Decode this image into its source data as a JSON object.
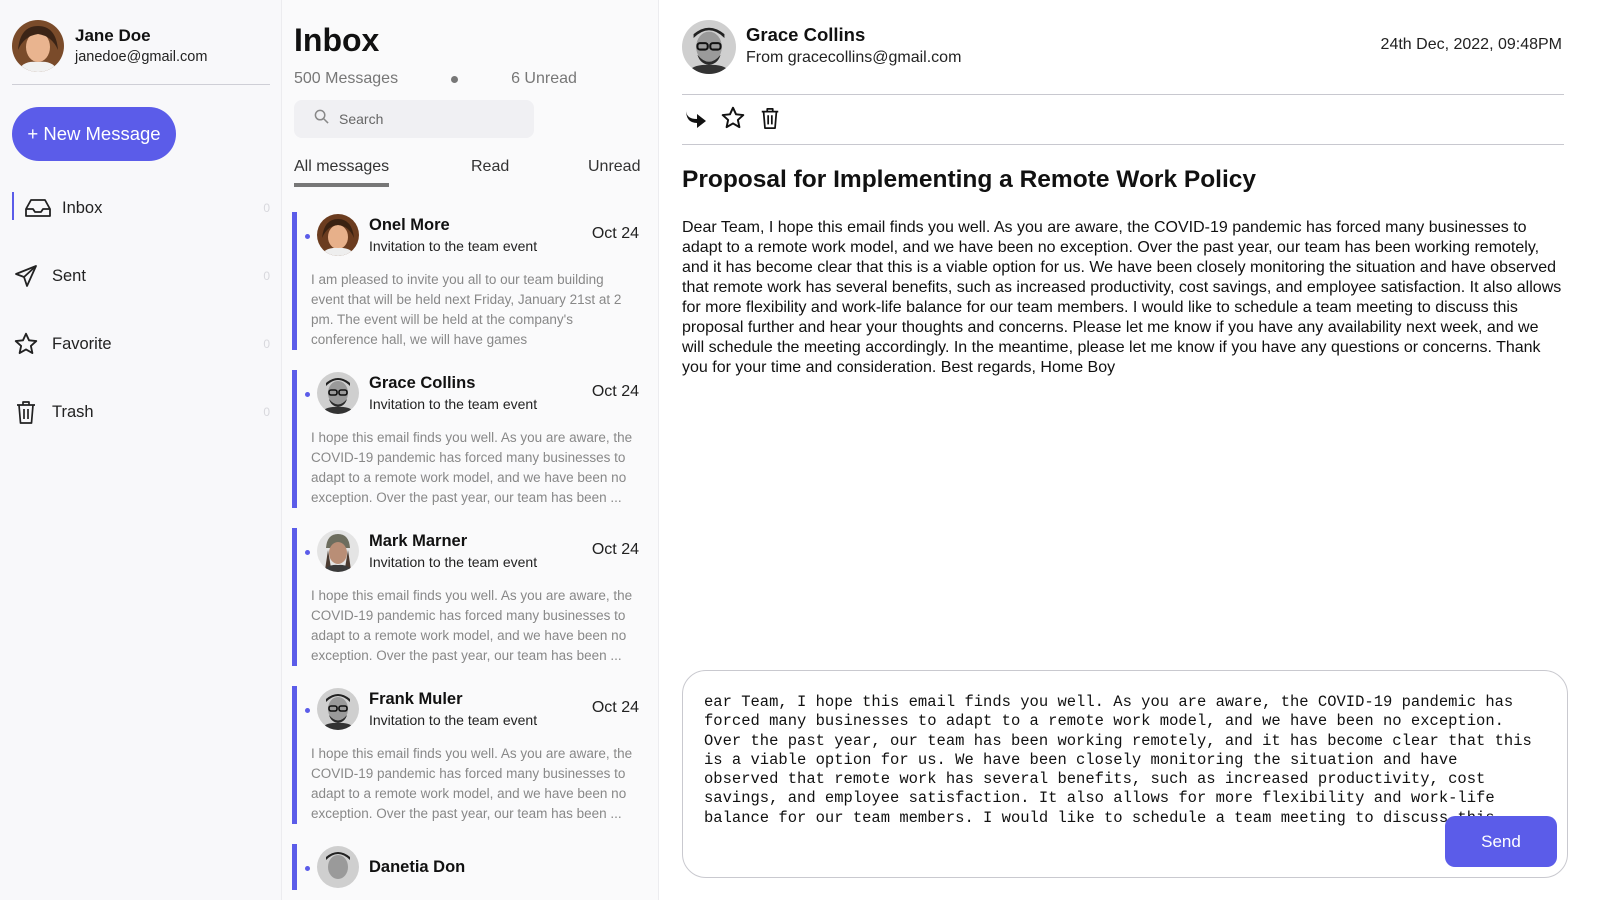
{
  "user": {
    "name": "Jane Doe",
    "email": "janedoe@gmail.com"
  },
  "sidebar": {
    "new_message_label": "+ New Message",
    "items": [
      {
        "label": "Inbox",
        "icon": "inbox-icon",
        "count": "0"
      },
      {
        "label": "Sent",
        "icon": "send-icon",
        "count": "0"
      },
      {
        "label": "Favorite",
        "icon": "star-icon",
        "count": "0"
      },
      {
        "label": "Trash",
        "icon": "trash-icon",
        "count": "0"
      }
    ]
  },
  "inbox": {
    "title": "Inbox",
    "total_label": "500 Messages",
    "unread_label": "6 Unread",
    "search_placeholder": "Search",
    "tabs": [
      "All messages",
      "Read",
      "Unread"
    ]
  },
  "messages": [
    {
      "sender": "Onel More",
      "subject": "Invitation to the team event",
      "date": "Oct 24",
      "preview": "I am pleased to invite you all to our team building event that will be held next Friday, January 21st at 2 pm. The event will be held at the company's conference hall, we will have games"
    },
    {
      "sender": "Grace Collins",
      "subject": "Invitation to the team event",
      "date": "Oct 24",
      "preview": "I hope this email finds you well. As you are aware, the COVID-19 pandemic has forced many businesses to adapt to a remote work model, and we have been no exception. Over the past year, our team has been ..."
    },
    {
      "sender": "Mark Marner",
      "subject": "Invitation to the team event",
      "date": "Oct 24",
      "preview": "I hope this email finds you well. As you are aware, the COVID-19 pandemic has forced many businesses to adapt to a remote work model, and we have been no exception. Over the past year, our team has been ..."
    },
    {
      "sender": "Frank Muler",
      "subject": "Invitation to the team event",
      "date": "Oct 24",
      "preview": "I hope this email finds you well. As you are aware, the COVID-19 pandemic has forced many businesses to adapt to a remote work model, and we have been no exception. Over the past year, our team has been ..."
    },
    {
      "sender": "Danetia Don",
      "subject": "",
      "date": "",
      "preview": ""
    }
  ],
  "reading": {
    "from_name": "Grace Collins",
    "from_line": "From gracecollins@gmail.com",
    "date": "24th Dec, 2022, 09:48PM",
    "subject": "Proposal for Implementing a Remote Work Policy",
    "body": "Dear Team, I hope this email finds you well. As you are aware, the COVID-19 pandemic has forced many businesses to adapt to a remote work model, and we have been no exception. Over the past year, our team has been working remotely, and it has become clear that this is a viable option for us. We have been closely monitoring the situation and have observed that remote work has several benefits, such as increased productivity, cost savings, and employee satisfaction. It also allows for more flexibility and work-life balance for our team members. I would like to schedule a team meeting to discuss this proposal further and hear your thoughts and concerns. Please let me know if you have any availability next week, and we will schedule the meeting accordingly. In the meantime, please let me know if you have any questions or concerns. Thank you for your time and consideration. Best regards, Home Boy",
    "actions": [
      "reply-icon",
      "star-icon",
      "trash-icon"
    ]
  },
  "reply": {
    "text": "ear Team, I hope this email finds you well. As you are aware, the COVID-19 pandemic has forced many businesses to adapt to a remote work model, and we have been no exception. Over the past year, our team has been working remotely, and it has become clear that this is a viable option for us. We have been closely monitoring the situation and have observed that remote work has several benefits, such as increased productivity, cost savings, and employee satisfaction. It also allows for more flexibility and work-life balance for our team members. I would like to schedule a team meeting to discuss this proposal further and hear your thoughts and concerns. Please let me know if you have any availability",
    "send_label": "Send"
  },
  "colors": {
    "accent": "#5b5ce9"
  }
}
